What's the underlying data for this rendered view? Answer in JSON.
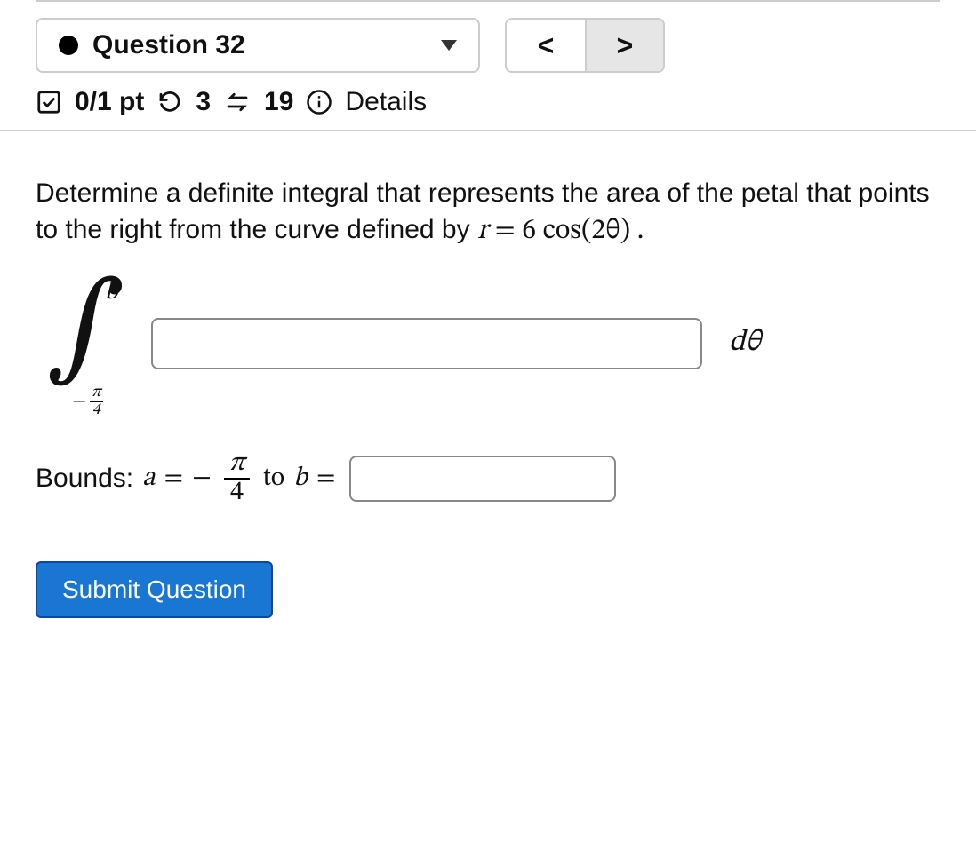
{
  "nav": {
    "question_label": "Question 32",
    "prev": "<",
    "next": ">"
  },
  "meta": {
    "score": "0/1 pt",
    "attempts": "3",
    "tries_remaining": "19",
    "details_label": "Details"
  },
  "prompt": {
    "text": "Determine a definite integral that represents the area of the petal that points to the right from the curve defined by",
    "equation_lhs": "r",
    "equation_eq": " = ",
    "equation_rhs": "6 cos(2θ)",
    "period": " ."
  },
  "integral": {
    "upper": "b",
    "lower_minus": "−",
    "lower_num": "π",
    "lower_den": "4",
    "differential": "dθ",
    "integrand_value": ""
  },
  "bounds": {
    "label": "Bounds: ",
    "a_var": "a",
    "eq": " = ",
    "minus": "−",
    "frac_num": "π",
    "frac_den": "4",
    "to": " to ",
    "b_var": "b",
    "b_value": ""
  },
  "submit": {
    "label": "Submit Question"
  }
}
